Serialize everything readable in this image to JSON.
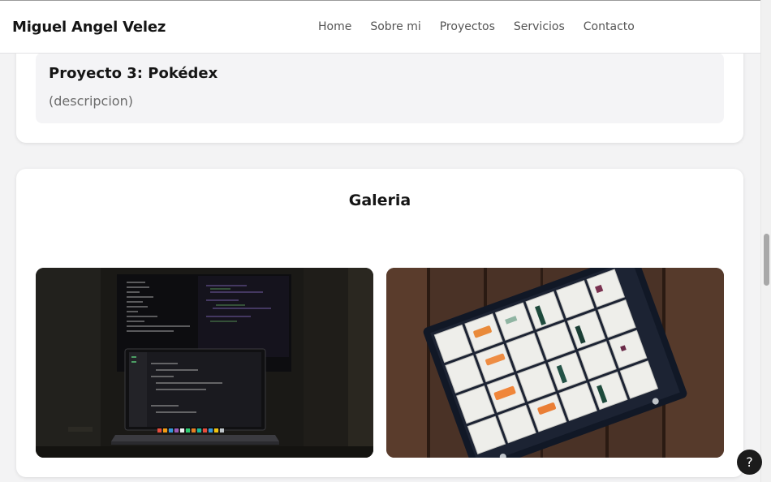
{
  "header": {
    "brand": "Miguel Angel Velez",
    "nav": [
      "Home",
      "Sobre mi",
      "Proyectos",
      "Servicios",
      "Contacto"
    ]
  },
  "projects": {
    "item3": {
      "title": "Proyecto 3: Pokédex",
      "description": "(descripcion)"
    }
  },
  "gallery": {
    "title": "Galeria",
    "images": [
      {
        "subject": "laptop-and-monitor-with-code"
      },
      {
        "subject": "tray-of-mineral-specimens"
      }
    ]
  },
  "help": {
    "label": "?"
  },
  "colors": {
    "card_bg": "#ffffff",
    "page_bg": "#f3f3f4",
    "project_box_bg": "#f4f4f6",
    "help_button_bg": "#1b1b1b"
  }
}
